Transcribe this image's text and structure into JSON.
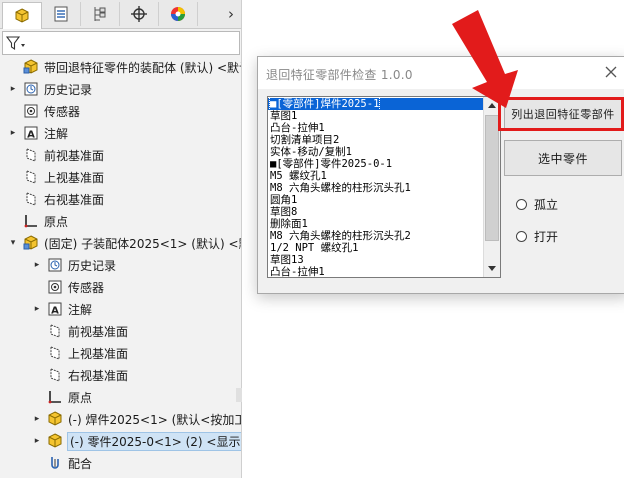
{
  "panel": {
    "tabs": [
      {
        "icon": "feature-manager-icon",
        "active": true
      },
      {
        "icon": "property-manager-icon",
        "active": false
      },
      {
        "icon": "configuration-manager-icon",
        "active": false
      },
      {
        "icon": "dimxpert-icon",
        "active": false
      },
      {
        "icon": "display-manager-icon",
        "active": false
      }
    ],
    "more_tabs_glyph": "›",
    "filter_icon": "funnel-icon"
  },
  "tree": [
    {
      "label": "带回退特征零件的装配体 (默认) <默认_显",
      "icon": "assembly-icon",
      "indent": 0,
      "expander": ""
    },
    {
      "label": "历史记录",
      "icon": "history-icon",
      "indent": 1,
      "expander": "▸"
    },
    {
      "label": "传感器",
      "icon": "sensor-icon",
      "indent": 1,
      "expander": ""
    },
    {
      "label": "注解",
      "icon": "annotation-icon",
      "indent": 1,
      "expander": "▸"
    },
    {
      "label": "前视基准面",
      "icon": "plane-icon",
      "indent": 1,
      "expander": ""
    },
    {
      "label": "上视基准面",
      "icon": "plane-icon",
      "indent": 1,
      "expander": ""
    },
    {
      "label": "右视基准面",
      "icon": "plane-icon",
      "indent": 1,
      "expander": ""
    },
    {
      "label": "原点",
      "icon": "origin-icon",
      "indent": 1,
      "expander": ""
    },
    {
      "label": "(固定) 子装配体2025<1> (默认) <默",
      "icon": "subassembly-icon",
      "indent": 0,
      "expander": "▾"
    },
    {
      "label": "历史记录",
      "icon": "history-icon",
      "indent": 2,
      "expander": "▸"
    },
    {
      "label": "传感器",
      "icon": "sensor-icon",
      "indent": 2,
      "expander": ""
    },
    {
      "label": "注解",
      "icon": "annotation-icon",
      "indent": 2,
      "expander": "▸"
    },
    {
      "label": "前视基准面",
      "icon": "plane-icon",
      "indent": 2,
      "expander": ""
    },
    {
      "label": "上视基准面",
      "icon": "plane-icon",
      "indent": 2,
      "expander": ""
    },
    {
      "label": "右视基准面",
      "icon": "plane-icon",
      "indent": 2,
      "expander": ""
    },
    {
      "label": "原点",
      "icon": "origin-icon",
      "indent": 2,
      "expander": ""
    },
    {
      "label": "(-) 焊件2025<1> (默认<按加工",
      "icon": "part-icon",
      "indent": 2,
      "expander": "▸"
    },
    {
      "label": "(-) 零件2025-0<1> (2) <显示",
      "icon": "part-icon",
      "indent": 2,
      "expander": "▸",
      "selected": true
    },
    {
      "label": "配合",
      "icon": "mates-icon",
      "indent": 2,
      "expander": ""
    }
  ],
  "dialog": {
    "title": "退回特征零部件检查 1.0.0",
    "close_icon": "close-icon",
    "list_items": [
      "■[零部件]焊件2025-1",
      "草图1",
      "凸台-拉伸1",
      "切割清单项目2",
      "实体-移动/复制1",
      "■[零部件]零件2025-0-1",
      "M5 螺纹孔1",
      "M8 六角头螺栓的柱形沉头孔1",
      "圆角1",
      "草图8",
      "删除面1",
      "M8 六角头螺栓的柱形沉头孔2",
      "1/2 NPT 螺纹孔1",
      "草图13",
      "凸台-拉伸1"
    ],
    "selected_index": 0,
    "btn_list": "列出退回特征零部件",
    "btn_select": "选中零件",
    "radio_isolate": "孤立",
    "radio_open": "打开"
  },
  "colors": {
    "annotation_red": "#e21b1b",
    "selection_blue": "#0a64d6"
  }
}
